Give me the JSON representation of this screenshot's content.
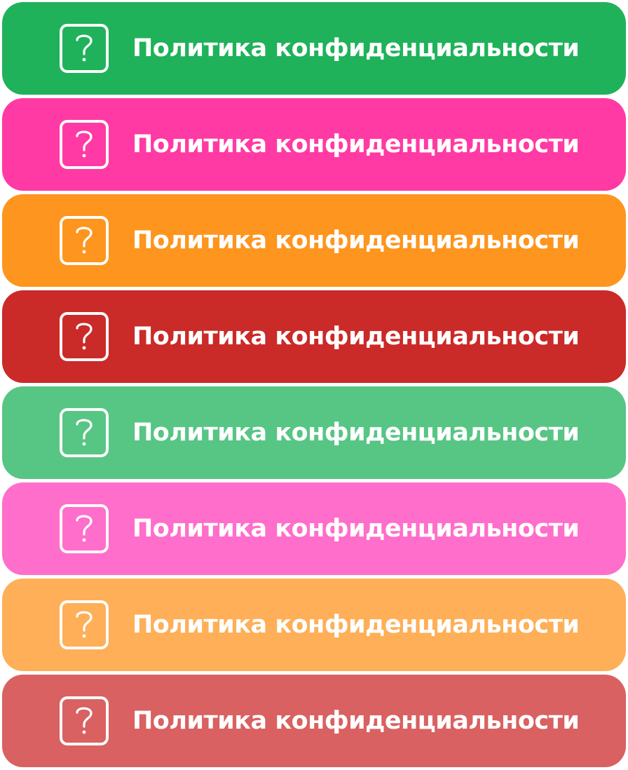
{
  "buttons": [
    {
      "label": "Политика конфиденциальности",
      "icon": "question-mark-icon",
      "color": "#1fb25a"
    },
    {
      "label": "Политика конфиденциальности",
      "icon": "question-mark-icon",
      "color": "#ff3aa4"
    },
    {
      "label": "Политика конфиденциальности",
      "icon": "question-mark-icon",
      "color": "#fe951e"
    },
    {
      "label": "Политика конфиденциальности",
      "icon": "question-mark-icon",
      "color": "#ca2a28"
    },
    {
      "label": "Политика конфиденциальности",
      "icon": "question-mark-icon",
      "color": "#57c584"
    },
    {
      "label": "Политика конфиденциальности",
      "icon": "question-mark-icon",
      "color": "#ff6ecb"
    },
    {
      "label": "Политика конфиденциальности",
      "icon": "question-mark-icon",
      "color": "#feaf58"
    },
    {
      "label": "Политика конфиденциальности",
      "icon": "question-mark-icon",
      "color": "#d96161"
    }
  ]
}
